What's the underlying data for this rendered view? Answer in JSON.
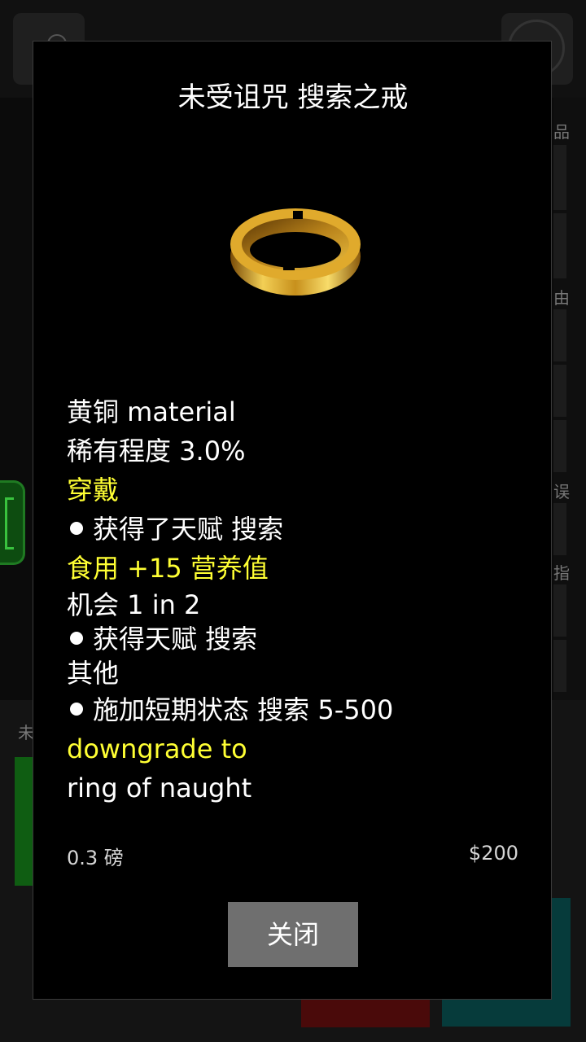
{
  "background": {
    "right_col_labels": [
      "品",
      "由",
      "误",
      "指"
    ],
    "bottom_label": "未"
  },
  "dialog": {
    "title": "未受诅咒 搜索之戒",
    "item_icon": "brass-ring",
    "lines": {
      "material": "黄铜 material",
      "rarity": "稀有程度 3.0%",
      "wear_header": "穿戴",
      "wear_effect": "获得了天赋 搜索",
      "eat_header": "食用 +15 营养值",
      "chance": "机会 1 in 2",
      "eat_effect": "获得天赋 搜索",
      "other_header": "其他",
      "other_effect": "施加短期状态 搜索 5-500",
      "downgrade_header": "downgrade to",
      "downgrade_target": "ring of naught"
    },
    "weight": "0.3 磅",
    "price": "$200",
    "close_label": "关闭"
  },
  "colors": {
    "highlight": "#ffff33",
    "button": "#6f6f6f",
    "ring_gold": "#d9a623"
  }
}
